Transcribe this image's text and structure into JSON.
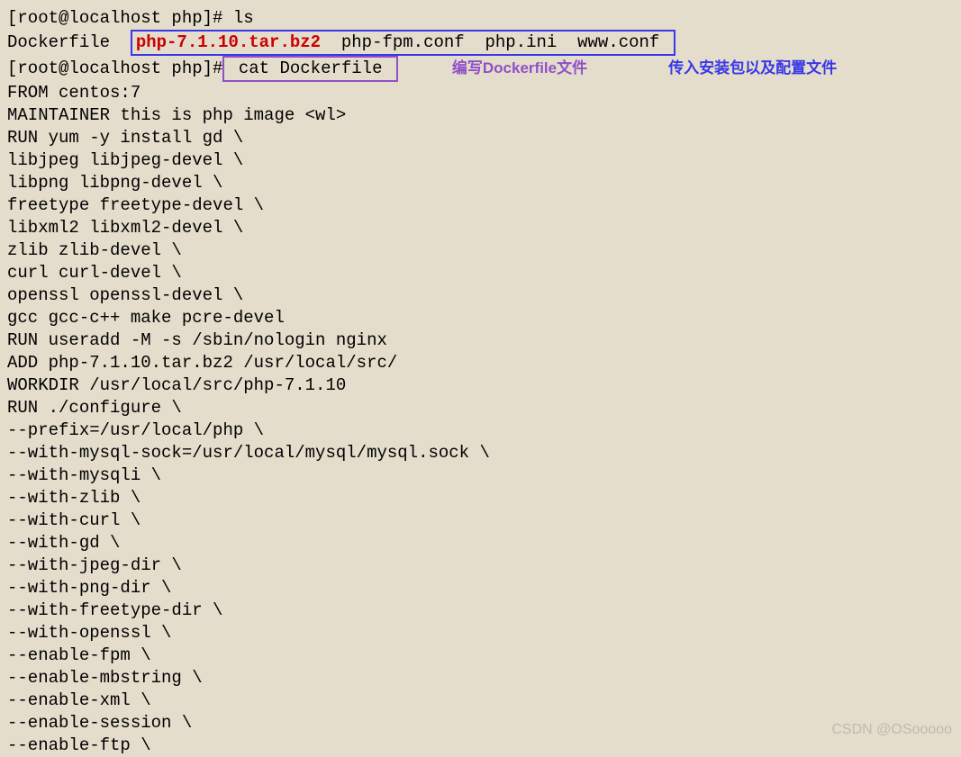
{
  "terminal": {
    "prompt1": "[root@localhost php]# ",
    "cmd1": "ls",
    "ls_prefix": "Dockerfile  ",
    "ls_highlight": "php-7.1.10.tar.bz2",
    "ls_rest": "  php-fpm.conf  php.ini  www.conf ",
    "prompt2": "[root@localhost php]#",
    "cmd2": " cat Dockerfile ",
    "annotation1": "编写Dockerfile文件",
    "annotation2": "传入安装包以及配置文件",
    "dockerfile": {
      "l1": "FROM centos:7",
      "l2": "MAINTAINER this is php image <wl>",
      "l3": "RUN yum -y install gd \\",
      "l4": "libjpeg libjpeg-devel \\",
      "l5": "libpng libpng-devel \\",
      "l6": "freetype freetype-devel \\",
      "l7": "libxml2 libxml2-devel \\",
      "l8": "zlib zlib-devel \\",
      "l9": "curl curl-devel \\",
      "l10": "openssl openssl-devel \\",
      "l11": "gcc gcc-c++ make pcre-devel",
      "l12": "RUN useradd -M -s /sbin/nologin nginx",
      "l13": "ADD php-7.1.10.tar.bz2 /usr/local/src/",
      "l14": "WORKDIR /usr/local/src/php-7.1.10",
      "l15": "RUN ./configure \\",
      "l16": "--prefix=/usr/local/php \\",
      "l17": "--with-mysql-sock=/usr/local/mysql/mysql.sock \\",
      "l18": "--with-mysqli \\",
      "l19": "--with-zlib \\",
      "l20": "--with-curl \\",
      "l21": "--with-gd \\",
      "l22": "--with-jpeg-dir \\",
      "l23": "--with-png-dir \\",
      "l24": "--with-freetype-dir \\",
      "l25": "--with-openssl \\",
      "l26": "--enable-fpm \\",
      "l27": "--enable-mbstring \\",
      "l28": "--enable-xml \\",
      "l29": "--enable-session \\",
      "l30": "--enable-ftp \\"
    }
  },
  "watermark": "CSDN @OSooooo"
}
